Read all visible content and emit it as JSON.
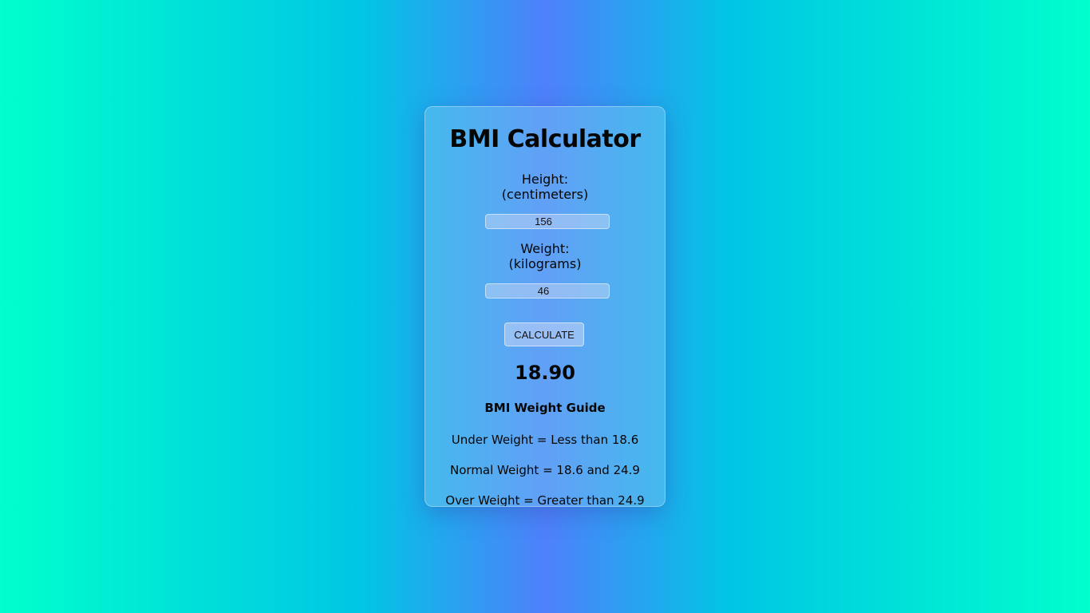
{
  "app": {
    "title": "BMI Calculator"
  },
  "form": {
    "height_label": "Height:",
    "height_unit": "(centimeters)",
    "height_value": "156",
    "weight_label": "Weight:",
    "weight_unit": "(kilograms)",
    "weight_value": "46",
    "calculate_label": "CALCULATE"
  },
  "result": {
    "bmi": "18.90"
  },
  "guide": {
    "title": "BMI Weight Guide",
    "lines": [
      "Under Weight = Less than 18.6",
      "Normal Weight = 18.6 and 24.9",
      "Over Weight = Greater than 24.9"
    ]
  }
}
